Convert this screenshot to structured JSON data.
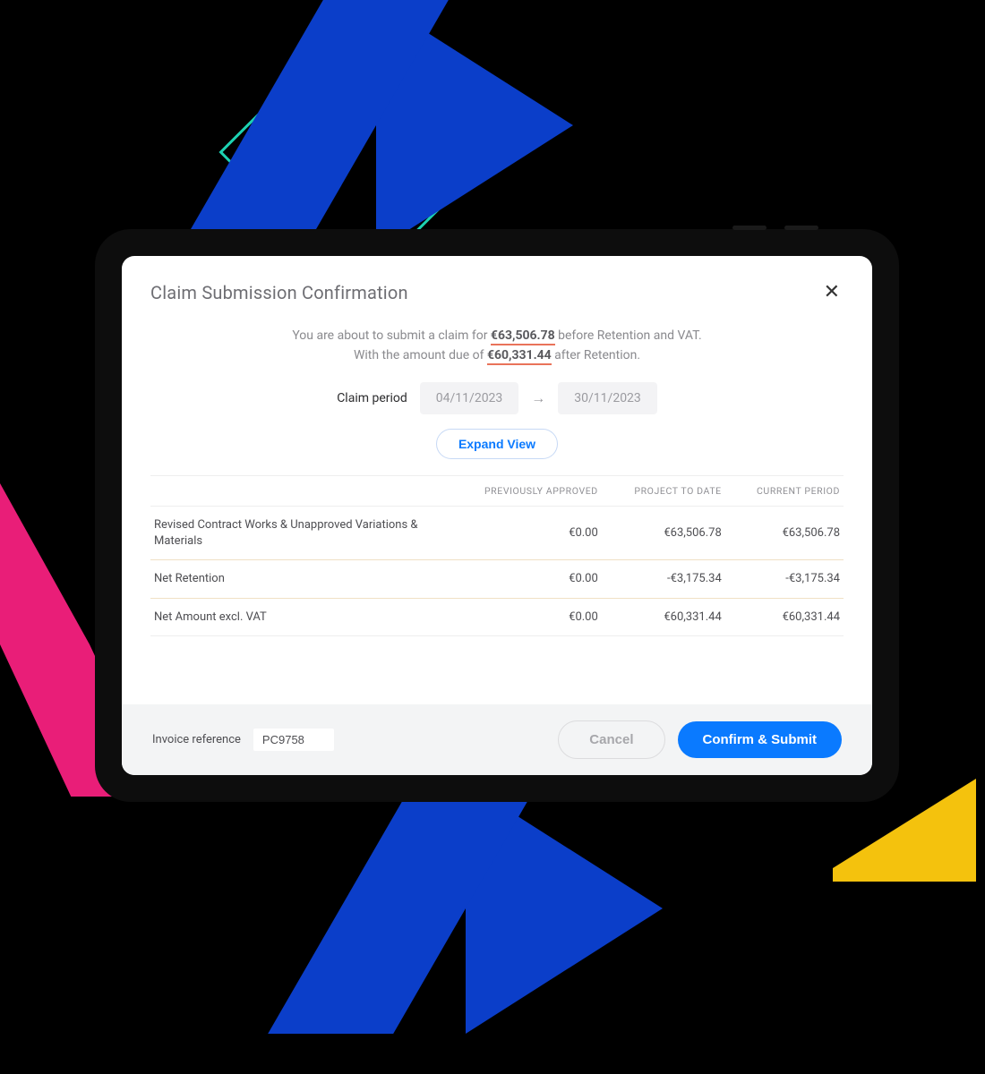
{
  "modal": {
    "title": "Claim Submission Confirmation",
    "summary": {
      "line1_prefix": "You are about to submit a claim for ",
      "amount_before": "€63,506.78",
      "line1_suffix": " before Retention and VAT.",
      "line2_prefix": "With the amount due of ",
      "amount_after": "€60,331.44",
      "line2_suffix": " after Retention."
    },
    "claim_period": {
      "label": "Claim period",
      "start": "04/11/2023",
      "end": "30/11/2023"
    },
    "expand_label": "Expand View",
    "table": {
      "headers": {
        "col0": "",
        "col1": "PREVIOUSLY APPROVED",
        "col2": "PROJECT TO DATE",
        "col3": "CURRENT PERIOD"
      },
      "rows": [
        {
          "label": "Revised Contract Works & Unapproved Variations & Materials",
          "prev": "€0.00",
          "ptd": "€63,506.78",
          "cur": "€63,506.78"
        },
        {
          "label": "Net Retention",
          "prev": "€0.00",
          "ptd": "-€3,175.34",
          "cur": "-€3,175.34"
        },
        {
          "label": "Net Amount excl. VAT",
          "prev": "€0.00",
          "ptd": "€60,331.44",
          "cur": "€60,331.44"
        }
      ]
    }
  },
  "footer": {
    "invoice_label": "Invoice reference",
    "invoice_value": "PC9758",
    "cancel_label": "Cancel",
    "confirm_label": "Confirm & Submit"
  }
}
